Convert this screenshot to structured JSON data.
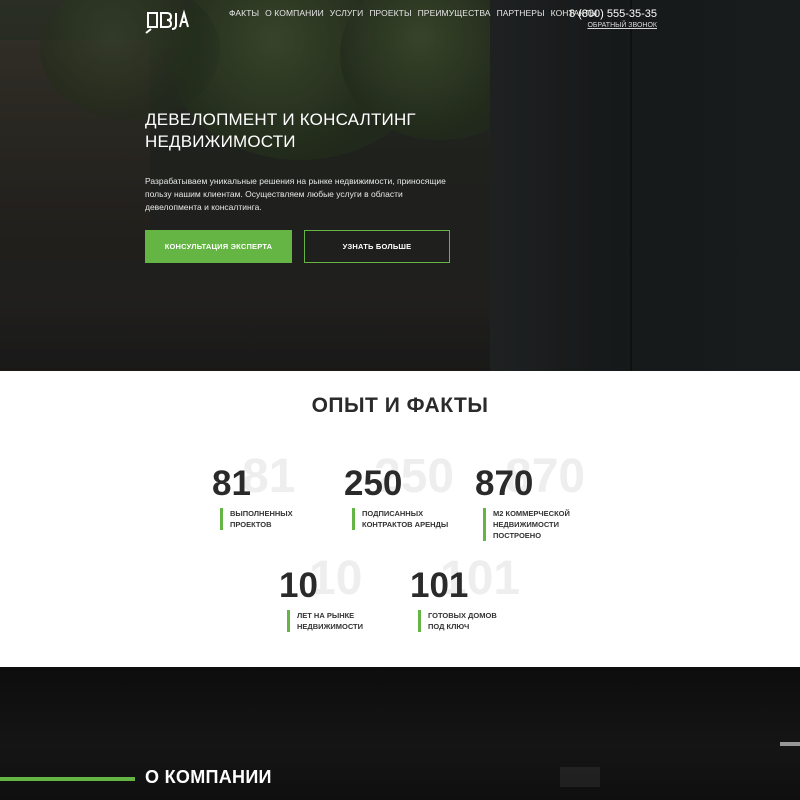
{
  "header": {
    "logo_text": "ОВЈА",
    "nav": [
      "ФАКТЫ",
      "О КОМПАНИИ",
      "УСЛУГИ",
      "ПРОЕКТЫ",
      "ПРЕИМУЩЕСТВА",
      "ПАРТНЕРЫ",
      "КОНТАКТЫ"
    ],
    "phone": "8 (800) 555-35-35",
    "callback": "ОБРАТНЫЙ ЗВОНОК"
  },
  "hero": {
    "title": "ДЕВЕЛОПМЕНТ И КОНСАЛТИНГ НЕДВИЖИМОСТИ",
    "text": "Разрабатываем уникальные решения на рынке недвижимости, приносящие пользу нашим клиентам. Осуществляем любые услуги в области девелопмента и консалтинга.",
    "btn_primary": "КОНСУЛЬТАЦИЯ ЭКСПЕРТА",
    "btn_secondary": "УЗНАТЬ БОЛЬШЕ"
  },
  "facts": {
    "title": "ОПЫТ И ФАКТЫ",
    "items": [
      {
        "number": "81",
        "label_lines": [
          "ВЫПОЛНЕННЫХ",
          "ПРОЕКТОВ"
        ]
      },
      {
        "number": "250",
        "label_lines": [
          "ПОДПИСАННЫХ",
          "КОНТРАКТОВ АРЕНДЫ"
        ]
      },
      {
        "number": "870",
        "label_lines": [
          "М2 КОММЕРЧЕСКОЙ",
          "НЕДВИЖИМОСТИ",
          "ПОСТРОЕНО"
        ]
      },
      {
        "number": "10",
        "label_lines": [
          "ЛЕТ НА РЫНКЕ",
          "НЕДВИЖИМОСТИ"
        ]
      },
      {
        "number": "101",
        "label_lines": [
          "ГОТОВЫХ ДОМОВ",
          "ПОД КЛЮЧ"
        ]
      }
    ]
  },
  "about": {
    "title": "О КОМПАНИИ"
  },
  "colors": {
    "accent": "#64b544",
    "dark_text": "#2a2a2a"
  }
}
